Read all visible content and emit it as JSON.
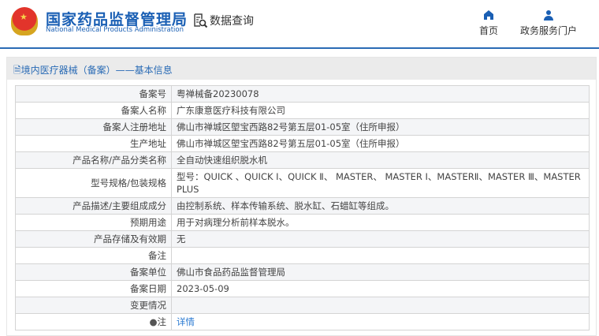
{
  "header": {
    "title_cn": "国家药品监督管理局",
    "title_en": "National Medical Products Administration",
    "data_query": "数据查询",
    "nav": [
      {
        "label": "首页",
        "icon": "home-icon"
      },
      {
        "label": "政务服务门户",
        "icon": "user-icon"
      }
    ]
  },
  "panel": {
    "title": "境内医疗器械（备案）——基本信息"
  },
  "rows": [
    {
      "k": "备案号",
      "v": "粤禅械备20230078"
    },
    {
      "k": "备案人名称",
      "v": "广东康意医疗科技有限公司"
    },
    {
      "k": "备案人注册地址",
      "v": "佛山市禅城区塱宝西路82号第五层01-05室（住所申报）"
    },
    {
      "k": "生产地址",
      "v": "佛山市禅城区塱宝西路82号第五层01-05室（住所申报）"
    },
    {
      "k": "产品名称/产品分类名称",
      "v": "全自动快速组织脱水机"
    },
    {
      "k": "型号规格/包装规格",
      "v": "型号：QUICK 、QUICK Ⅰ、QUICK Ⅱ、 MASTER、 MASTER Ⅰ、MASTERⅡ、MASTER Ⅲ、MASTER PLUS"
    },
    {
      "k": "产品描述/主要组成成分",
      "v": "由控制系统、样本传输系统、脱水缸、石蜡缸等组成。"
    },
    {
      "k": "预期用途",
      "v": "用于对病理分析前样本脱水。"
    },
    {
      "k": "产品存储及有效期",
      "v": "无"
    },
    {
      "k": "备注",
      "v": ""
    },
    {
      "k": "备案单位",
      "v": "佛山市食品药品监督管理局"
    },
    {
      "k": "备案日期",
      "v": "2023-05-09"
    },
    {
      "k": "变更情况",
      "v": ""
    },
    {
      "k": "注",
      "v": "详情"
    }
  ]
}
